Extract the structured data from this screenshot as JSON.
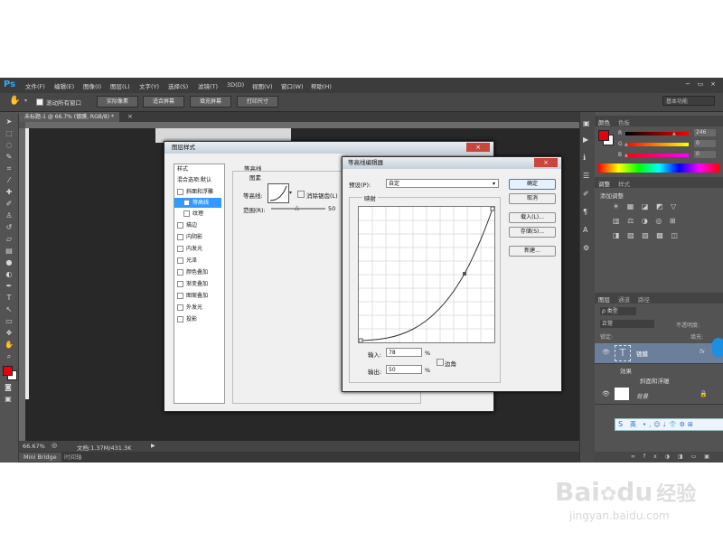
{
  "menubar": {
    "logo": "Ps",
    "items": [
      "文件(F)",
      "编辑(E)",
      "图像(I)",
      "图层(L)",
      "文字(Y)",
      "选择(S)",
      "滤镜(T)",
      "3D(D)",
      "视图(V)",
      "窗口(W)",
      "帮助(H)"
    ],
    "win_min": "−",
    "win_max": "▭",
    "win_close": "×"
  },
  "optbar": {
    "scroll_all_label": "滚动所有窗口",
    "btn_actual": "实际像素",
    "btn_fit": "适合屏幕",
    "btn_fill": "填充屏幕",
    "btn_print": "打印尺寸",
    "workspace": "基本功能"
  },
  "document": {
    "tab": "未标题-1 @ 66.7% (镀膜, RGB/8) *",
    "zoom": "66.67%",
    "doc_info": "文档:1.37M/431.3K"
  },
  "bottomtabs": {
    "mini_bridge": "Mini Bridge",
    "timeline": "时间轴"
  },
  "panels": {
    "color_tab": "颜色",
    "swatches_tab": "色板",
    "r_label": "R",
    "r_value": "246",
    "g_label": "G",
    "g_value": "0",
    "b_label": "B",
    "b_value": "0",
    "adjust_tab": "调整",
    "styles_tab": "样式",
    "adjust_add": "添加调整",
    "layers_tab": "图层",
    "channels_tab": "通道",
    "paths_tab": "路径",
    "filter_kind": "ρ 类型",
    "blend_mode": "正常",
    "opacity_label": "不透明度:",
    "lock_label": "锁定:",
    "fill_label": "填充:",
    "layer_text_name": "镀膜",
    "effects_label": "效果",
    "bevel_effect": "斜面和浮雕",
    "bg_layer_name": "背景",
    "fx_label": "fx"
  },
  "layer_style_dialog": {
    "title": "图层样式",
    "list_header": "样式",
    "blend_default": "混合选项:默认",
    "items": [
      "斜面和浮雕",
      "等高线",
      "纹理",
      "描边",
      "内阴影",
      "内发光",
      "光泽",
      "颜色叠加",
      "渐变叠加",
      "图案叠加",
      "外发光",
      "投影"
    ],
    "section_title": "等高线",
    "group_title": "图素",
    "contour_label": "等高线:",
    "anti_alias": "消除锯齿(L)",
    "range_label": "范围(R):",
    "range_value": "50"
  },
  "contour_editor": {
    "title": "等高线编辑器",
    "preset_label": "预设(P):",
    "preset_value": "自定",
    "mapping_label": "映射",
    "input_label": "输入:",
    "input_value": "78",
    "input_unit": "%",
    "output_label": "输出:",
    "output_value": "50",
    "output_unit": "%",
    "corner_label": "边角",
    "ok": "确定",
    "cancel": "取消",
    "load": "载入(L)...",
    "save": "存储(S)...",
    "new": "新建..."
  },
  "ime": {
    "lang": "英"
  },
  "watermark": {
    "brand_a": "Bai",
    "brand_b": "du",
    "brand_c": "经验",
    "url": "jingyan.baidu.com"
  },
  "colors": {
    "foreground": "#e8000d",
    "background": "#ffffff",
    "accent": "#3399ff"
  }
}
